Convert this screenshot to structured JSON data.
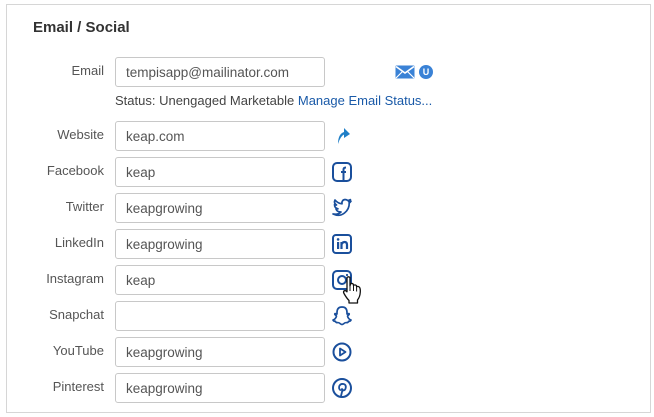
{
  "section": {
    "title": "Email / Social"
  },
  "email": {
    "label": "Email",
    "value": "tempisapp@mailinator.com",
    "status_prefix": "Status: Unengaged Marketable",
    "manage_link": "Manage Email Status...",
    "badge_letter": "U",
    "mail_icon": "envelope-icon"
  },
  "fields": [
    {
      "label": "Website",
      "value": "keap.com",
      "icon": "go-arrow-icon"
    },
    {
      "label": "Facebook",
      "value": "keap",
      "icon": "facebook-icon"
    },
    {
      "label": "Twitter",
      "value": "keapgrowing",
      "icon": "twitter-icon"
    },
    {
      "label": "LinkedIn",
      "value": "keapgrowing",
      "icon": "linkedin-icon"
    },
    {
      "label": "Instagram",
      "value": "keap",
      "icon": "instagram-icon"
    },
    {
      "label": "Snapchat",
      "value": "",
      "icon": "snapchat-icon"
    },
    {
      "label": "YouTube",
      "value": "keapgrowing",
      "icon": "youtube-icon"
    },
    {
      "label": "Pinterest",
      "value": "keapgrowing",
      "icon": "pinterest-icon"
    }
  ],
  "colors": {
    "icon_blue": "#1a4f9c",
    "link_blue": "#1a5aa8",
    "badge_blue": "#3a82d6"
  }
}
